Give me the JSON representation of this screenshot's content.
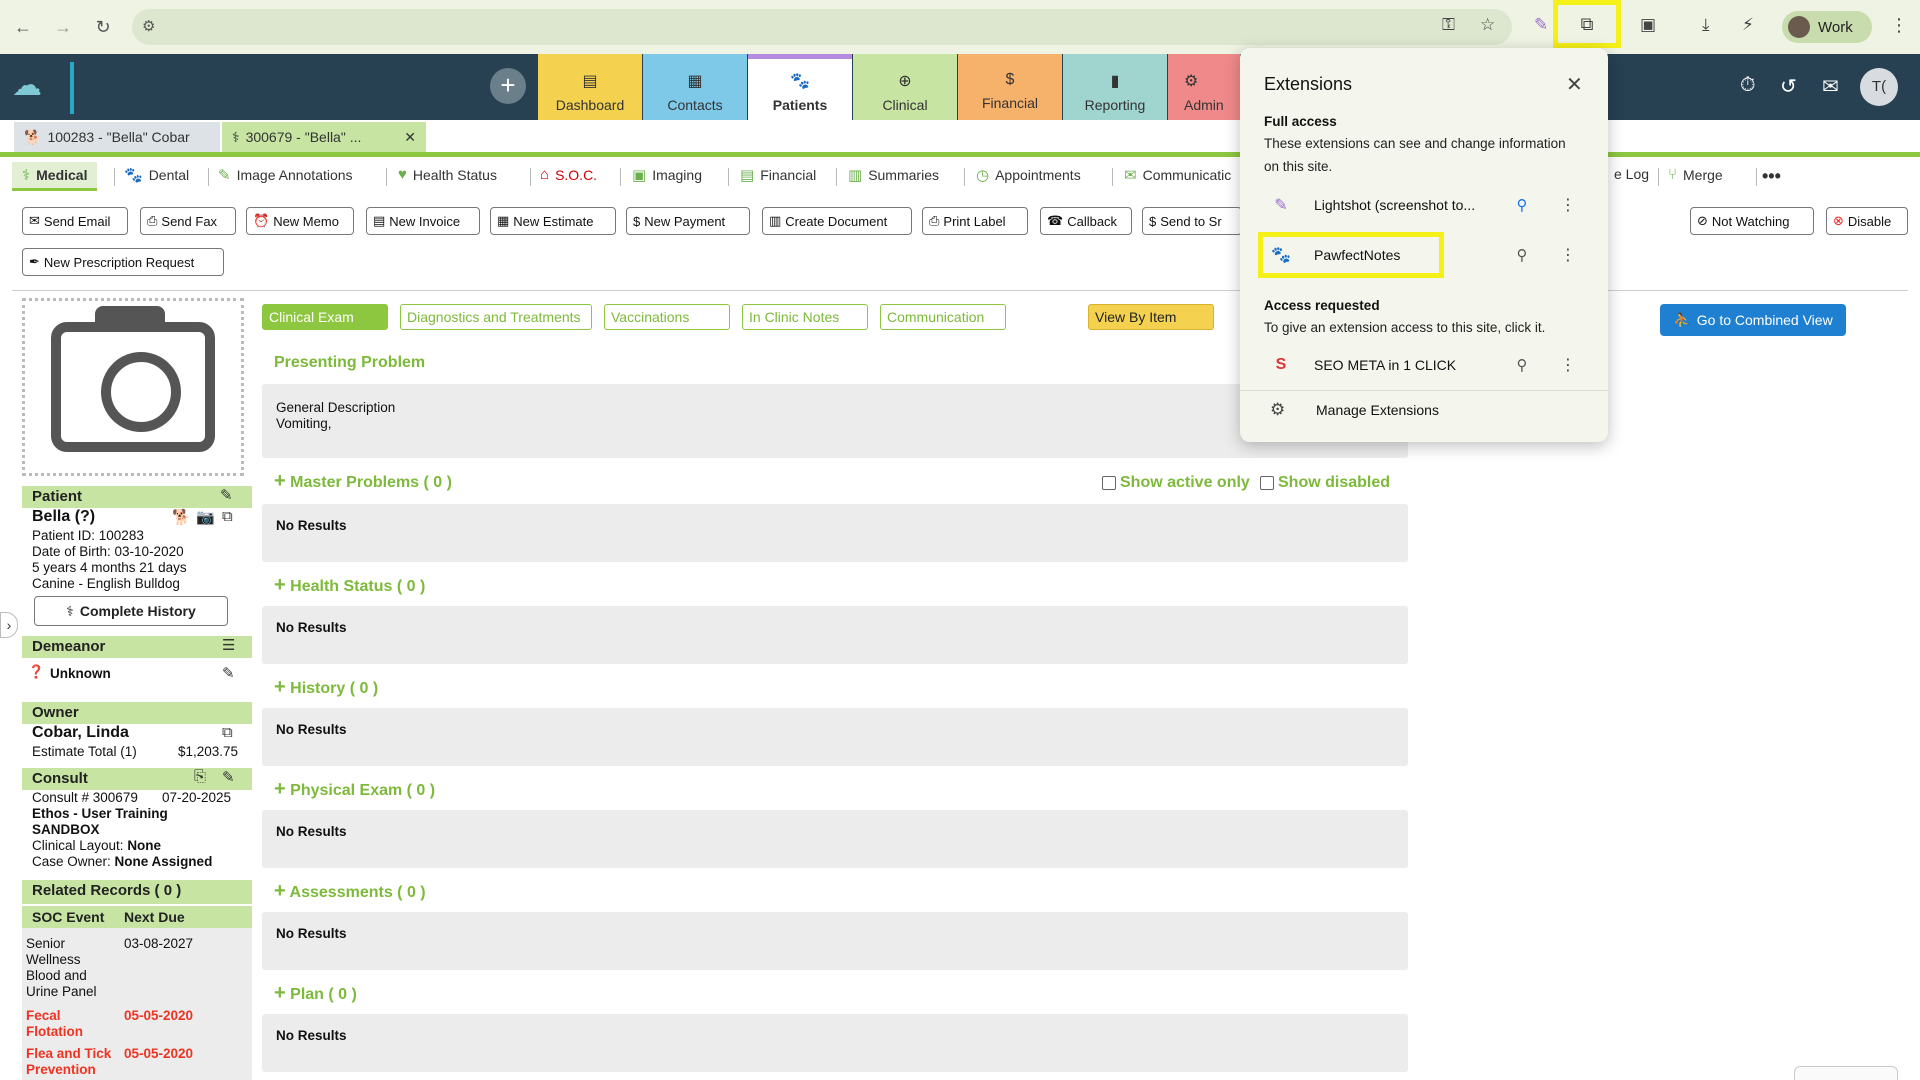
{
  "browser": {
    "profile_label": "Work",
    "icons": [
      "back-icon",
      "forward-icon",
      "reload-icon",
      "site-settings-icon",
      "password-key-icon",
      "bookmark-star-icon",
      "lightshot-pen-icon",
      "extensions-puzzle-icon",
      "tab-search-icon",
      "download-icon",
      "performance-icon",
      "profile-avatar-icon",
      "menu-kebab-icon"
    ]
  },
  "header": {
    "tabs": [
      {
        "label": "Dashboard",
        "color": "#f4d250"
      },
      {
        "label": "Contacts",
        "color": "#7ec9e8"
      },
      {
        "label": "Patients",
        "color": "#b48be0"
      },
      {
        "label": "Clinical",
        "color": "#c7e4a3"
      },
      {
        "label": "Financial",
        "color": "#f6b26b"
      },
      {
        "label": "Reporting",
        "color": "#9fd4cf"
      },
      {
        "label": "Admin",
        "color": "#f08a8a"
      }
    ],
    "avatar": "T("
  },
  "record_tabs": [
    {
      "label": "100283 - \"Bella\" Cobar"
    },
    {
      "label": "300679 - \"Bella\" ..."
    }
  ],
  "section_nav": [
    "Medical",
    "Dental",
    "Image Annotations",
    "Health Status",
    "S.O.C.",
    "Imaging",
    "Financial",
    "Summaries",
    "Appointments",
    "Communicatic",
    "e Log",
    "Merge"
  ],
  "actions": [
    "Send Email",
    "Send Fax",
    "New Memo",
    "New Invoice",
    "New Estimate",
    "New Payment",
    "Create Document",
    "Print Label",
    "Callback",
    "Send to Sr",
    "Not Watching",
    "Disable",
    "New Prescription Request"
  ],
  "sidebar": {
    "patient_header": "Patient",
    "patient_name": "Bella (?)",
    "patient_id": "Patient ID: 100283",
    "dob": "Date of Birth: 03-10-2020",
    "age": "5 years 4 months 21 days",
    "species": "Canine - English Bulldog",
    "complete_history": "Complete History",
    "demeanor_header": "Demeanor",
    "demeanor_value": "Unknown",
    "owner_header": "Owner",
    "owner_name": "Cobar, Linda",
    "estimate_label": "Estimate Total (1)",
    "estimate_value": "$1,203.75",
    "consult_header": "Consult",
    "consult_no": "Consult # 300679",
    "consult_date": "07-20-2025",
    "consult_org_1": "Ethos - User Training",
    "consult_org_2": "SANDBOX",
    "clinical_layout_label": "Clinical Layout:",
    "clinical_layout_value": "None",
    "case_owner_label": "Case Owner:",
    "case_owner_value": "None Assigned",
    "related_header": "Related Records ( 0 )",
    "soc_col1": "SOC Event",
    "soc_col2": "Next Due",
    "soc_rows": [
      {
        "event": [
          "Senior",
          "Wellness",
          "Blood and",
          "Urine Panel"
        ],
        "due": "03-08-2027",
        "overdue": false
      },
      {
        "event": [
          "Fecal",
          "Flotation"
        ],
        "due": "05-05-2020",
        "overdue": true
      },
      {
        "event": [
          "Flea and Tick",
          "Prevention"
        ],
        "due": "05-05-2020",
        "overdue": true
      }
    ]
  },
  "main": {
    "pills": [
      "Clinical Exam",
      "Diagnostics and Treatments",
      "Vaccinations",
      "In Clinic Notes",
      "Communication",
      "View By Item"
    ],
    "combined_view": "Go to Combined View",
    "presenting_problem": "Presenting Problem",
    "general_description": "General Description",
    "description_value": "Vomiting,",
    "show_active_only": "Show active only",
    "show_disabled": "Show disabled",
    "no_results": "No Results",
    "sections": [
      "Master Problems ( 0 )",
      "Health Status ( 0 )",
      "History ( 0 )",
      "Physical Exam ( 0 )",
      "Assessments ( 0 )",
      "Plan ( 0 )"
    ]
  },
  "extensions_popup": {
    "title": "Extensions",
    "full_access_title": "Full access",
    "full_access_desc": "These extensions can see and change information on this site.",
    "full_access_items": [
      "Lightshot (screenshot to...",
      "PawfectNotes"
    ],
    "access_requested_title": "Access requested",
    "access_requested_desc": "To give an extension access to this site, click it.",
    "requested_items": [
      "SEO META in 1 CLICK"
    ],
    "manage": "Manage Extensions"
  }
}
